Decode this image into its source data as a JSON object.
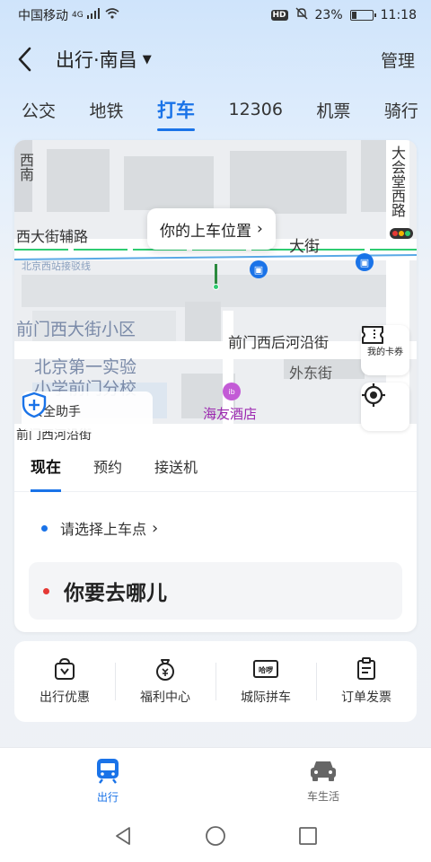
{
  "status_bar": {
    "carrier": "中国移动",
    "network": "4G",
    "hd": "HD",
    "battery": "23%",
    "time": "11:18"
  },
  "header": {
    "title": "出行·南昌",
    "manage": "管理"
  },
  "tabs": [
    "公交",
    "地铁",
    "打车",
    "12306",
    "机票",
    "骑行"
  ],
  "map": {
    "labels": {
      "top_right_vertical": "大会堂西路",
      "left_vertical": "西南",
      "road1": "西大街辅路",
      "road1b": "大街",
      "line": "北京西站接驳线",
      "community": "前门西大街小区",
      "school1": "北京第一实验",
      "school2": "小学前门分校",
      "road2": "前门西后河沿街",
      "road3": "外东街",
      "hotel": "海友酒店",
      "road4": "前门西河沿街"
    },
    "bubble": "你的上车位置",
    "card_button": "我的卡券",
    "safety": "安全助手"
  },
  "ride": {
    "tabs": [
      "现在",
      "预约",
      "接送机"
    ],
    "pickup": "请选择上车点",
    "destination": "你要去哪儿"
  },
  "services": [
    "出行优惠",
    "福利中心",
    "城际拼车",
    "订单发票"
  ],
  "bottom_nav": [
    "出行",
    "车生活"
  ],
  "colors": {
    "accent": "#1a73e8",
    "pickup_dot": "#1a73e8",
    "dest_dot": "#e53935"
  }
}
